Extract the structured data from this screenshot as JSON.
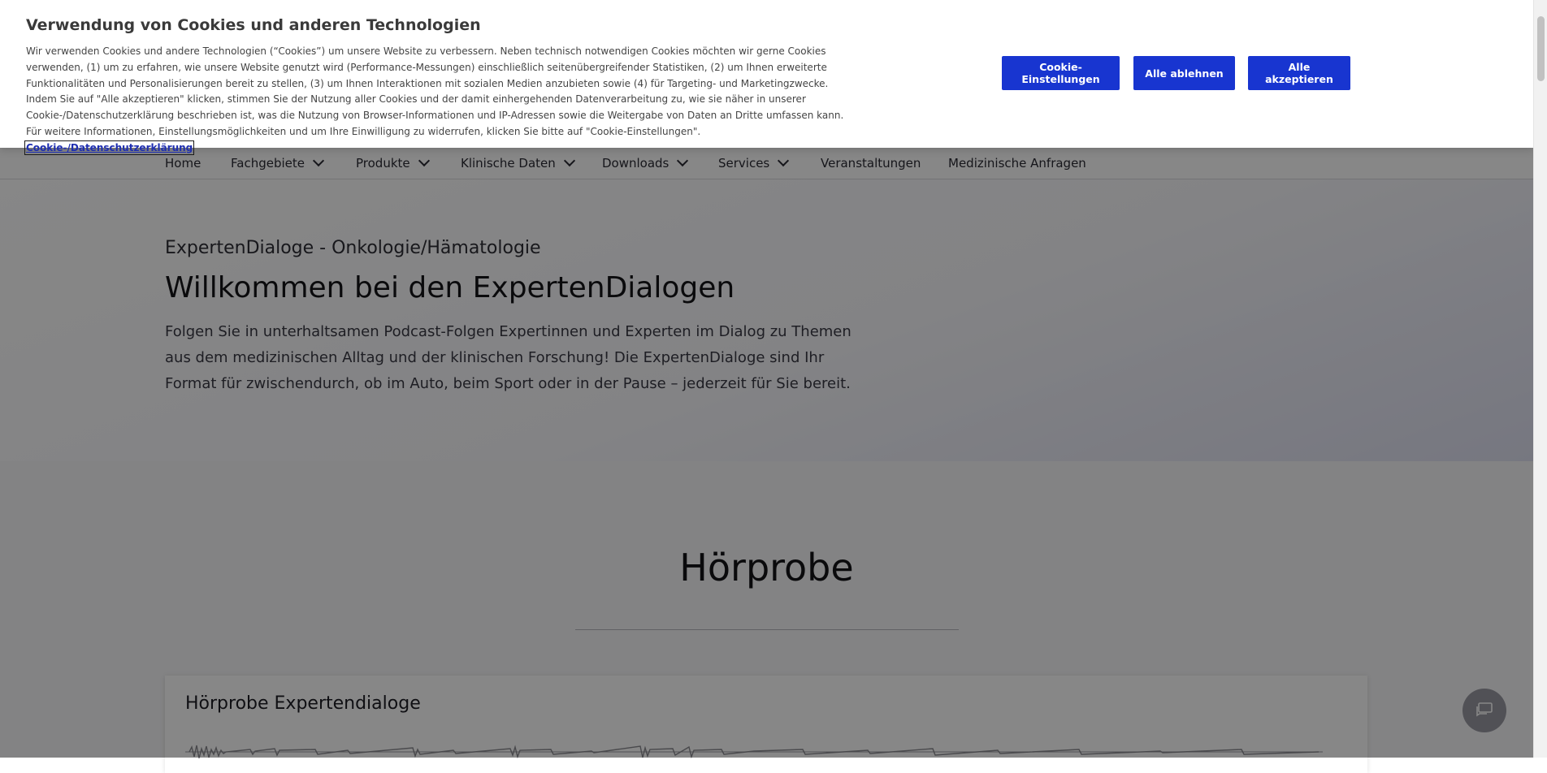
{
  "cookie_banner": {
    "title": "Verwendung von Cookies und anderen Technologien",
    "text": "Wir verwenden Cookies und andere Technologien (“Cookies”) um unsere Website zu verbessern. Neben technisch notwendigen Cookies möchten wir gerne Cookies verwenden, (1) um zu erfahren, wie unsere Website genutzt wird (Performance-Messungen) einschließlich seitenübergreifender Statistiken, (2) um Ihnen erweiterte Funktionalitäten und Personalisierungen bereit zu stellen, (3) um Ihnen Interaktionen mit sozialen Medien anzubieten sowie (4) für Targeting- und Marketingzwecke. Indem Sie auf \"Alle akzeptieren\" klicken, stimmen Sie der Nutzung aller Cookies und der damit einhergehenden Datenverarbeitung zu, wie sie näher in unserer Cookie-/Datenschutzerklärung beschrieben ist, was die Nutzung von Browser-Informationen und IP-Adressen sowie die Weitergabe von Daten an Dritte umfassen kann. Für weitere Informationen, Einstellungsmöglichkeiten und um Ihre Einwilligung zu widerrufen, klicken Sie bitte auf \"Cookie-Einstellungen\".",
    "link_label": "Cookie-/Datenschutzerklärung",
    "buttons": {
      "settings": "Cookie-Einstellungen",
      "reject": "Alle ablehnen",
      "accept": "Alle akzeptieren"
    },
    "button_color": "#1835d0"
  },
  "nav": {
    "items": [
      {
        "label": "Home",
        "dropdown": false
      },
      {
        "label": "Fachgebiete",
        "dropdown": true
      },
      {
        "label": "Produkte",
        "dropdown": true
      },
      {
        "label": "Klinische Daten",
        "dropdown": true
      },
      {
        "label": "Downloads",
        "dropdown": true
      },
      {
        "label": "Services",
        "dropdown": true
      },
      {
        "label": "Veranstaltungen",
        "dropdown": false
      },
      {
        "label": "Medizinische Anfragen",
        "dropdown": false
      }
    ]
  },
  "hero": {
    "eyebrow": "ExpertenDialoge - Onkologie/Hämatologie",
    "title": "Willkommen bei den ExpertenDialogen",
    "text": "Folgen Sie in unterhaltsamen Podcast-Folgen Expertinnen und Experten im Dialog zu Themen aus dem medizinischen Alltag und der klinischen Forschung! Die ExpertenDialoge sind Ihr Format für zwischendurch, ob im Auto, beim Sport oder in der Pause – jederzeit für Sie bereit."
  },
  "section": {
    "title": "Hörprobe"
  },
  "audio_card": {
    "title": "Hörprobe Expertendialoge"
  },
  "icons": {
    "chat": "chat-icon",
    "chevron": "chevron-down-icon"
  }
}
